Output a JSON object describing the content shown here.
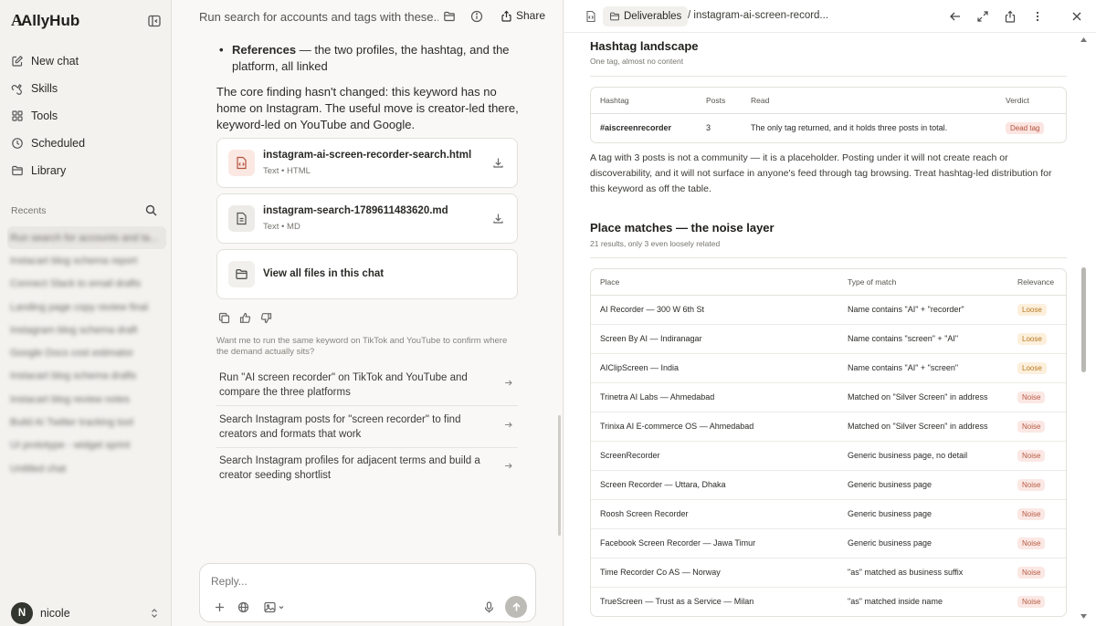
{
  "sidebar": {
    "brand": "AllyHub",
    "nav": [
      {
        "label": "New chat",
        "icon": "edit-icon"
      },
      {
        "label": "Skills",
        "icon": "skills-icon"
      },
      {
        "label": "Tools",
        "icon": "tools-icon"
      },
      {
        "label": "Scheduled",
        "icon": "clock-icon"
      },
      {
        "label": "Library",
        "icon": "folder-icon"
      }
    ],
    "recents_label": "Recents",
    "recents": [
      "Run search for accounts and ta...",
      "Instacart blog schema report",
      "Connect Slack to email drafts",
      "Landing page copy review final",
      "Instagram blog schema draft",
      "Google Docs cost estimator",
      "Instacart blog schema drafts",
      "Instacart blog review notes",
      "Build AI Twitter tracking tool",
      "UI prototype - widget sprint",
      "Untitled chat"
    ],
    "user": {
      "initial": "N",
      "name": "nicole"
    }
  },
  "chat": {
    "title": "Run search for accounts and tags with these...",
    "share_label": "Share",
    "bullet_label": "References",
    "bullet_text": " — the two profiles, the hashtag, and the platform, all linked",
    "paragraph": "The core finding hasn't changed: this keyword has no home on Instagram. The useful move is creator-led there, keyword-led on YouTube and Google.",
    "files": [
      {
        "name": "instagram-ai-screen-recorder-search.html",
        "meta": "Text • HTML"
      },
      {
        "name": "instagram-search-1789611483620.md",
        "meta": "Text • MD"
      }
    ],
    "view_all_label": "View all files in this chat",
    "ask": "Want me to run the same keyword on TikTok and YouTube to confirm where the demand actually sits?",
    "suggestions": [
      "Run \"AI screen recorder\" on TikTok and YouTube and compare the three platforms",
      "Search Instagram posts for \"screen recorder\" to find creators and formats that work",
      "Search Instagram profiles for adjacent terms and build a creator seeding shortlist"
    ],
    "reply_placeholder": "Reply..."
  },
  "doc": {
    "crumb_folder": "Deliverables",
    "crumb_file": "/ instagram-ai-screen-record...",
    "hashtag": {
      "title": "Hashtag landscape",
      "subtitle": "One tag, almost no content",
      "headers": [
        "Hashtag",
        "Posts",
        "Read",
        "Verdict"
      ],
      "rows": [
        {
          "tag": "#aiscreenrecorder",
          "posts": "3",
          "read": "The only tag returned, and it holds three posts in total.",
          "verdict": "Dead tag"
        }
      ],
      "paragraph": "A tag with 3 posts is not a community — it is a placeholder. Posting under it will not create reach or discoverability, and it will not surface in anyone's feed through tag browsing. Treat hashtag-led distribution for this keyword as off the table."
    },
    "places": {
      "title": "Place matches — the noise layer",
      "subtitle": "21 results, only 3 even loosely related",
      "headers": [
        "Place",
        "Type of match",
        "Relevance"
      ],
      "rows": [
        {
          "place": "AI Recorder — 300 W 6th St",
          "type": "Name contains \"AI\" + \"recorder\"",
          "relevance": "Loose",
          "level": "loose"
        },
        {
          "place": "Screen By AI — Indiranagar",
          "type": "Name contains \"screen\" + \"AI\"",
          "relevance": "Loose",
          "level": "loose"
        },
        {
          "place": "AIClipScreen — India",
          "type": "Name contains \"AI\" + \"screen\"",
          "relevance": "Loose",
          "level": "loose"
        },
        {
          "place": "Trinetra AI Labs — Ahmedabad",
          "type": "Matched on \"Silver Screen\" in address",
          "relevance": "Noise",
          "level": "noise"
        },
        {
          "place": "Trinixa AI E-commerce OS — Ahmedabad",
          "type": "Matched on \"Silver Screen\" in address",
          "relevance": "Noise",
          "level": "noise"
        },
        {
          "place": "ScreenRecorder",
          "type": "Generic business page, no detail",
          "relevance": "Noise",
          "level": "noise"
        },
        {
          "place": "Screen Recorder — Uttara, Dhaka",
          "type": "Generic business page",
          "relevance": "Noise",
          "level": "noise"
        },
        {
          "place": "Roosh Screen Recorder",
          "type": "Generic business page",
          "relevance": "Noise",
          "level": "noise"
        },
        {
          "place": "Facebook Screen Recorder — Jawa Timur",
          "type": "Generic business page",
          "relevance": "Noise",
          "level": "noise"
        },
        {
          "place": "Time Recorder Co AS — Norway",
          "type": "\"as\" matched as business suffix",
          "relevance": "Noise",
          "level": "noise"
        },
        {
          "place": "TrueScreen — Trust as a Service — Milan",
          "type": "\"as\" matched inside name",
          "relevance": "Noise",
          "level": "noise"
        }
      ]
    }
  },
  "colors": {
    "accent": "#b4513a",
    "loose": "#b87922",
    "noise": "#b75a44"
  }
}
